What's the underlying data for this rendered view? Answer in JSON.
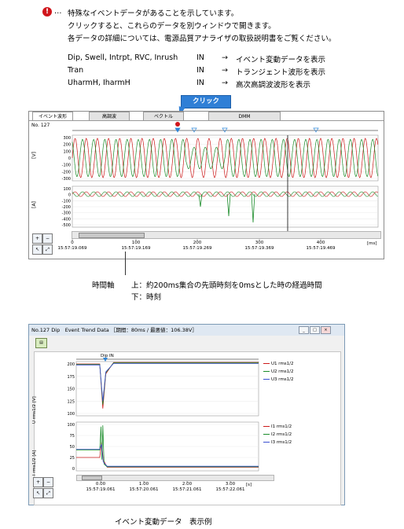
{
  "intro": {
    "icon_glyph": "!",
    "ellipsis": "…",
    "line1": "特殊なイベントデータがあることを示しています。",
    "line2": "クリックすると、これらのデータを別ウィンドウで開きます。",
    "line3": "各データの詳細については、電源品質アナライザの取扱説明書をご覧ください。"
  },
  "mapping": [
    {
      "data": "Dip, Swell, Intrpt, RVC, Inrush",
      "in": "IN",
      "arrow": "→",
      "desc": "イベント変動データを表示"
    },
    {
      "data": "Tran",
      "in": "IN",
      "arrow": "→",
      "desc": "トランジェント波形を表示"
    },
    {
      "data": "UharmH, IharmH",
      "in": "IN",
      "arrow": "→",
      "desc": "高次高調波波形を表示"
    }
  ],
  "click_label": "クリック",
  "wave_panel": {
    "tabs": [
      "イベント波形",
      "高調波",
      "ベクトル",
      "DMM"
    ],
    "record_no": "No. 127",
    "v_unit": "[V]",
    "a_unit": "[A]",
    "v_ticks": [
      "300",
      "200",
      "100",
      "0",
      "-100",
      "-200",
      "-300"
    ],
    "a_ticks": [
      "100",
      "0",
      "-100",
      "-200",
      "-300",
      "-400",
      "-500"
    ],
    "x_ticks": [
      "0",
      "100",
      "200",
      "300",
      "400"
    ],
    "x_unit": "[ms]",
    "x_times": [
      "15:57:19.069",
      "15:57:19.169",
      "15:57:19.269",
      "15:57:19.369",
      "15:57:19.469"
    ],
    "colors": {
      "voltage_red": "#cc1a1a",
      "voltage_green": "#1b8c2a",
      "current_red": "#cc1a1a",
      "current_green": "#1b8c2a",
      "marker_blue": "#2f86d8"
    }
  },
  "time_note": {
    "label": "時間軸",
    "upper": "上：約200ms集合の先頭時刻を0msとした時の経過時間",
    "lower": "下：時刻"
  },
  "trend_window": {
    "title": "No.127 Dip　Event Trend Data ［期間：80ms / 最悪値：106.38V］",
    "controls": [
      "_",
      "□",
      "×"
    ],
    "marker": "Dip IN",
    "u_axis": "U rms1/2 [V]",
    "i_axis": "I rms1/2 [A]",
    "u_ticks": [
      "200",
      "175",
      "150",
      "125",
      "100"
    ],
    "i_ticks": [
      "100",
      "75",
      "50",
      "25",
      "0"
    ],
    "x_ticks": [
      "0.00",
      "1.00",
      "2.00",
      "3.00"
    ],
    "x_unit": "[s]",
    "x_times": [
      "15:57:19.061",
      "15:57:20.061",
      "15:57:21.061",
      "15:57:22.061"
    ],
    "u_legend": [
      {
        "name": "U1 rms1/2",
        "color": "#cc1a1a"
      },
      {
        "name": "U2 rms1/2",
        "color": "#1b8c2a"
      },
      {
        "name": "U3 rms1/2",
        "color": "#3a4fd0"
      }
    ],
    "i_legend": [
      {
        "name": "I1 rms1/2",
        "color": "#cc1a1a"
      },
      {
        "name": "I2 rms1/2",
        "color": "#1b8c2a"
      },
      {
        "name": "I3 rms1/2",
        "color": "#3a4fd0"
      }
    ]
  },
  "caption": "イベント変動データ　表示例"
}
